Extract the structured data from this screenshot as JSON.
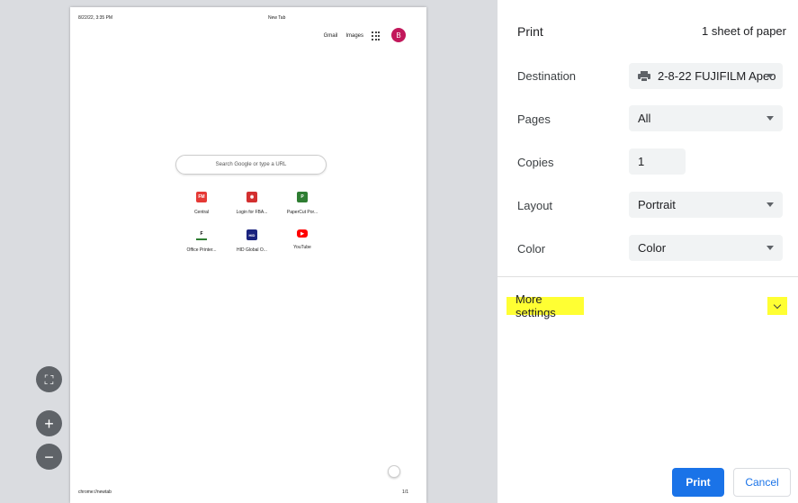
{
  "preview": {
    "header_date": "8/22/22, 3:35 PM",
    "header_title": "New Tab",
    "links": {
      "gmail": "Gmail",
      "images": "Images"
    },
    "avatar_letter": "B",
    "search_placeholder": "Search Google or type a URL",
    "shortcuts": [
      {
        "label": "Central",
        "icon_text": "FM",
        "color": "#e53935",
        "icon": "fm-icon"
      },
      {
        "label": "Login for FBA...",
        "icon_text": "◉",
        "color": "#d32f2f",
        "icon": "circle-logo-icon"
      },
      {
        "label": "PaperCut Por...",
        "icon_text": "P",
        "color": "#2e7d32",
        "icon": "papercut-icon"
      },
      {
        "label": "Office Printer...",
        "icon_text": "F",
        "color": "#ffffff",
        "icon": "f-logo-icon"
      },
      {
        "label": "HID Global O...",
        "icon_text": "HID",
        "color": "#1a237e",
        "icon": "hid-icon"
      },
      {
        "label": "YouTube",
        "icon_text": "▶",
        "color": "#ff0000",
        "icon": "youtube-icon"
      }
    ],
    "footer_url": "chrome://newtab",
    "page_number": "1/1"
  },
  "zoom": {
    "fit": "⛶",
    "plus": "+",
    "minus": "−"
  },
  "panel": {
    "title": "Print",
    "sheets": "1 sheet of paper",
    "destination_label": "Destination",
    "destination_value": "2-8-22 FUJIFILM Apeo",
    "pages_label": "Pages",
    "pages_value": "All",
    "copies_label": "Copies",
    "copies_value": "1",
    "layout_label": "Layout",
    "layout_value": "Portrait",
    "color_label": "Color",
    "color_value": "Color",
    "more_settings": "More settings",
    "print_button": "Print",
    "cancel_button": "Cancel",
    "accent_color": "#1a73e8",
    "highlight_color": "#ffff33"
  }
}
